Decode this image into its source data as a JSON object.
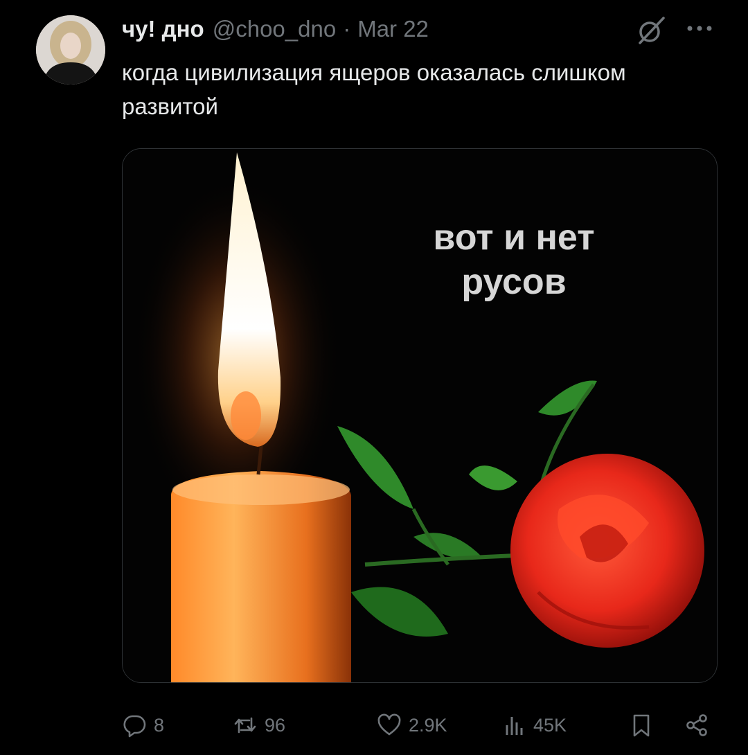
{
  "tweet": {
    "display_name": "чу! дно",
    "handle": "@choo_dno",
    "separator": "·",
    "date": "Mar 22",
    "text": "когда цивилизация ящеров оказалась слишком развитой"
  },
  "media": {
    "caption_line1": "вот и нет",
    "caption_line2": "русов"
  },
  "actions": {
    "replies": "8",
    "retweets": "96",
    "likes": "2.9K",
    "views": "45K"
  },
  "icons": {
    "grok": "grok-icon",
    "more": "more-icon",
    "reply": "reply-icon",
    "retweet": "retweet-icon",
    "like": "heart-icon",
    "views": "views-icon",
    "bookmark": "bookmark-icon",
    "share": "share-icon"
  },
  "colors": {
    "background": "#000000",
    "text_primary": "#e7e9ea",
    "text_secondary": "#71767b",
    "border": "#2f3336"
  }
}
